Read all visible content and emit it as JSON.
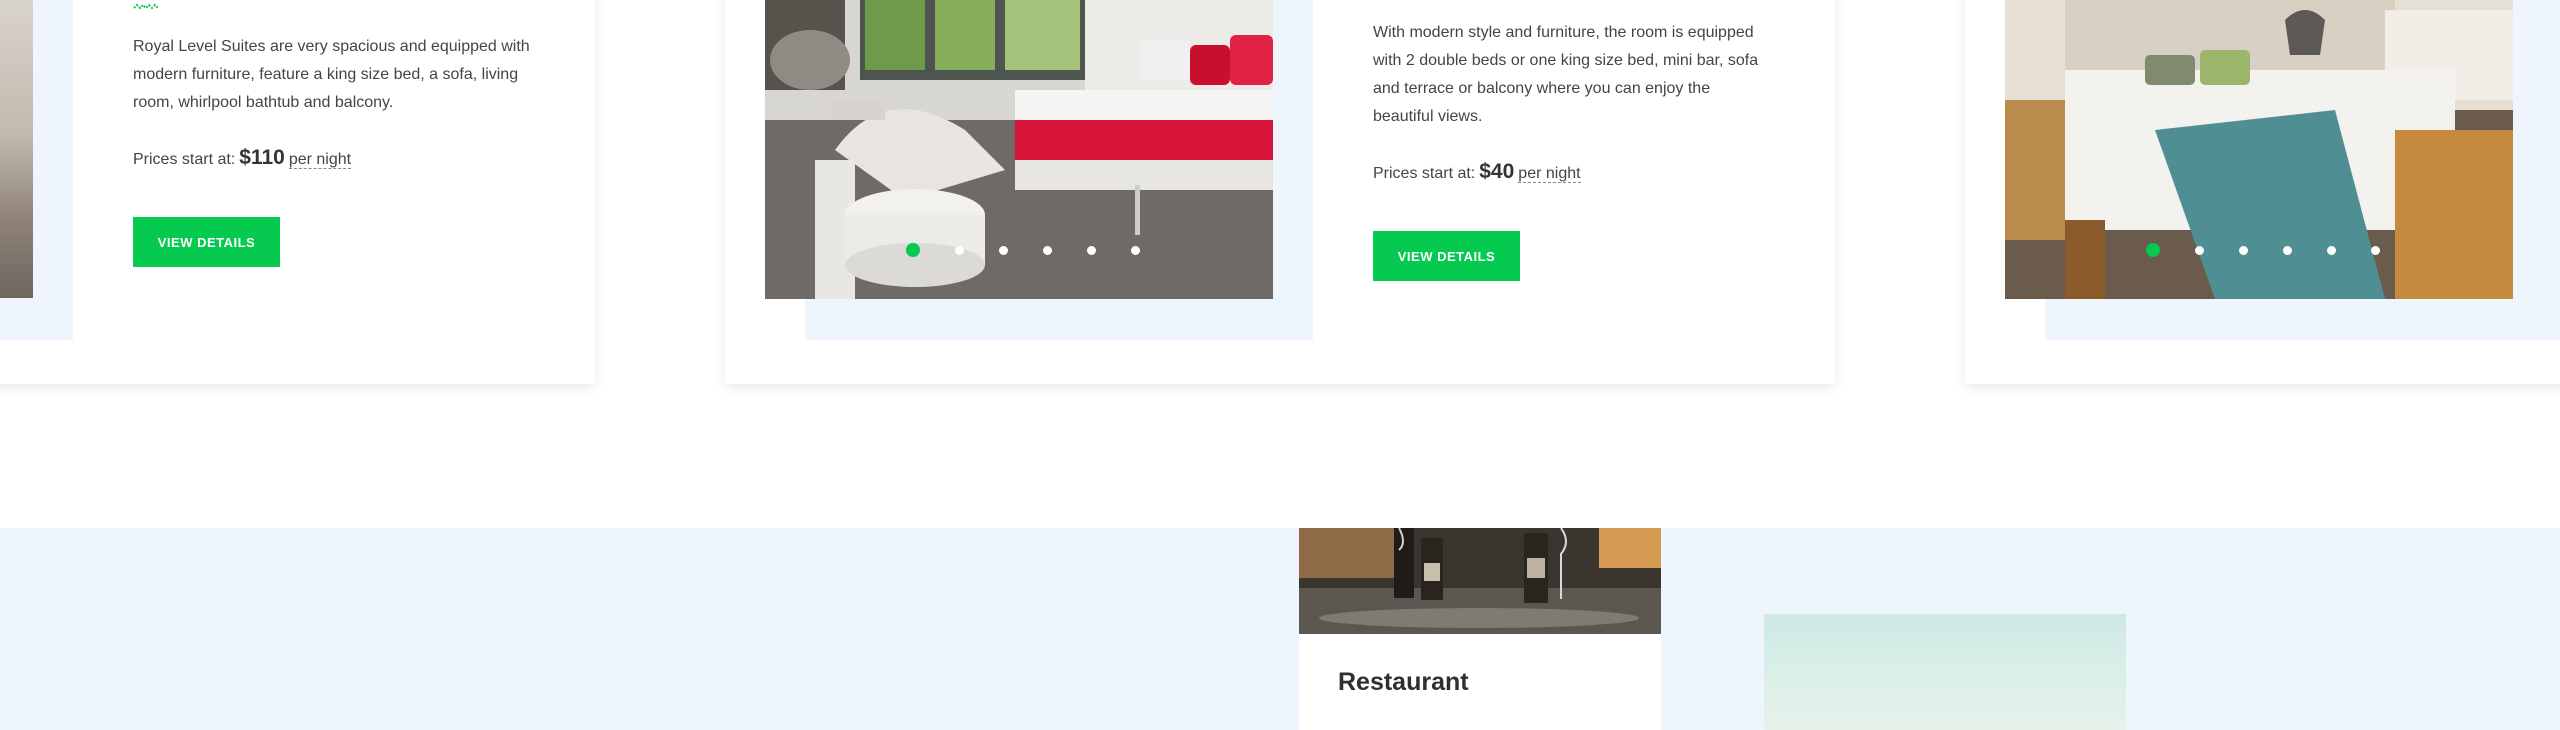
{
  "rooms": [
    {
      "description": "Royal Level Suites are very spacious and equipped with modern furniture, feature a king size bed, a sofa, living room, whirlpool bathtub and balcony.",
      "price_prefix": "Prices start at:",
      "price_amount": "$110",
      "price_unit": "per night",
      "button_label": "VIEW DETAILS"
    },
    {
      "description": "With modern style and furniture, the room is equipped with 2 double beds or one king size bed, mini bar, sofa and terrace or balcony where you can enjoy the beautiful views.",
      "price_prefix": "Prices start at:",
      "price_amount": "$40",
      "price_unit": "per night",
      "button_label": "VIEW DETAILS"
    }
  ],
  "services": {
    "restaurant_title": "Restaurant"
  },
  "colors": {
    "accent": "#06c94f",
    "tint": "#eef5fd"
  }
}
